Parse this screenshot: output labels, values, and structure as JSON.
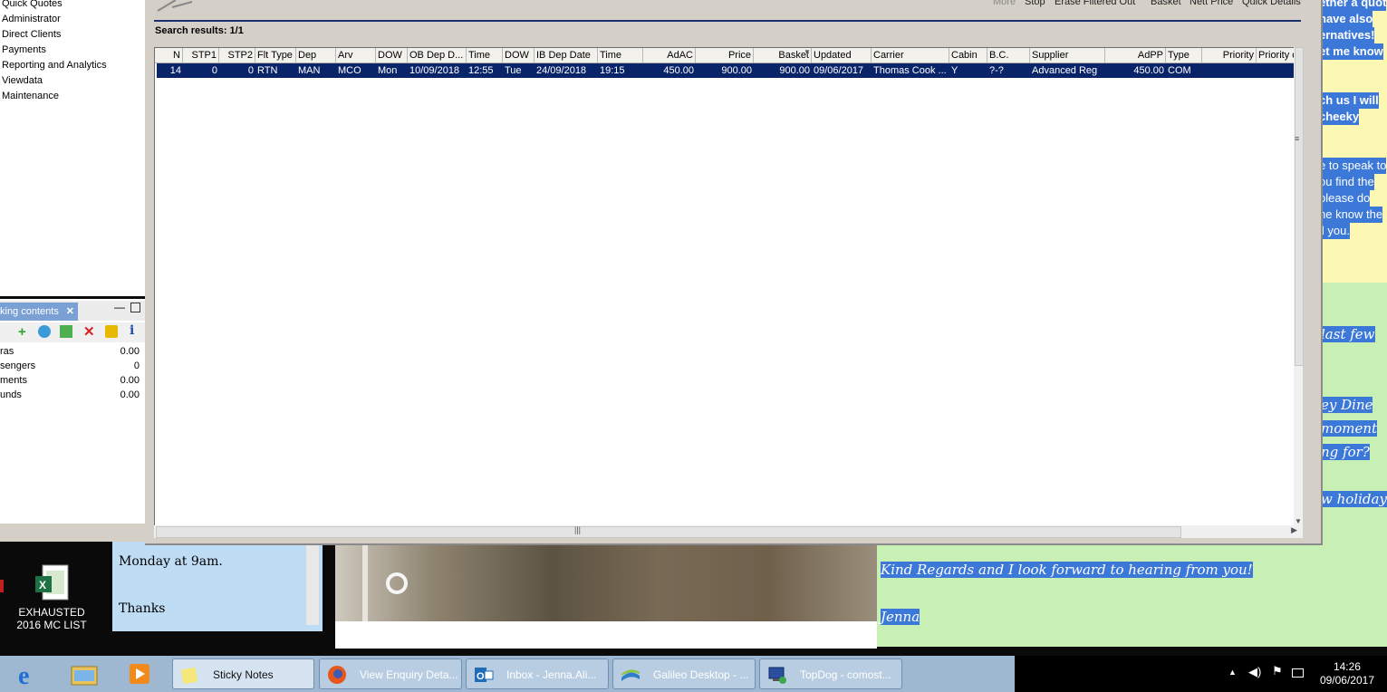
{
  "left_nav": {
    "items": [
      "Quick Quotes",
      "Administrator",
      "Direct Clients",
      "Payments",
      "Reporting and Analytics",
      "Viewdata",
      "Maintenance"
    ]
  },
  "basket_panel": {
    "tab_label": "king contents",
    "rows": [
      {
        "label": "ras",
        "value": "0.00"
      },
      {
        "label": "sengers",
        "value": "0"
      },
      {
        "label": "ments",
        "value": "0.00"
      },
      {
        "label": "unds",
        "value": "0.00"
      }
    ]
  },
  "toolbar": {
    "more": "More",
    "stop": "Stop",
    "erase": "Erase Filtered Out",
    "basket": "Basket",
    "nett_price": "Nett Price",
    "quick_details": "Quick Details"
  },
  "search": {
    "results_label": "Search results: 1/1"
  },
  "grid": {
    "columns": [
      "N",
      "STP1",
      "STP2",
      "Flt Type",
      "Dep",
      "Arv",
      "DOW",
      "OB Dep D...",
      "Time",
      "DOW",
      "IB Dep Date",
      "Time",
      "AdAC",
      "Price",
      "Basket",
      "Updated",
      "Carrier",
      "Cabin",
      "B.C.",
      "Supplier",
      "AdPP",
      "Type",
      "Priority",
      "Priority de"
    ],
    "rows": [
      [
        "14",
        "0",
        "0",
        "RTN",
        "MAN",
        "MCO",
        "Mon",
        "10/09/2018",
        "12:55",
        "Tue",
        "24/09/2018",
        "19:15",
        "450.00",
        "900.00",
        "900.00",
        "09/06/2017",
        "Thomas Cook ...",
        "Y",
        "?-?",
        "Advanced Reg",
        "450.00",
        "COM",
        "",
        ""
      ]
    ]
  },
  "sticky_yellow": {
    "lines": [
      "ether a quot",
      "have also",
      "ernatives!",
      "et me know",
      "",
      "",
      "ch us I will",
      "cheeky",
      "",
      "",
      "e to speak to",
      "ou find the",
      "please do",
      "he know the",
      "ll you."
    ]
  },
  "sticky_green": {
    "fragments": [
      "last few",
      "ey Dine",
      "moment",
      "ng for?",
      "w holiday"
    ],
    "closing": "Kind Regards and I look forward to hearing from you!",
    "signature": "Jenna"
  },
  "sticky_blue": {
    "line1": "Monday at 9am.",
    "line2": "Thanks"
  },
  "desktop_icon": {
    "label_line1": "EXHAUSTED",
    "label_line2": "2016 MC LIST"
  },
  "taskbar": {
    "buttons": [
      "Sticky Notes",
      "View Enquiry Deta...",
      "Inbox - Jenna.Ali...",
      "Galileo Desktop - ...",
      "TopDog - comost..."
    ],
    "time": "14:26",
    "date": "09/06/2017"
  }
}
